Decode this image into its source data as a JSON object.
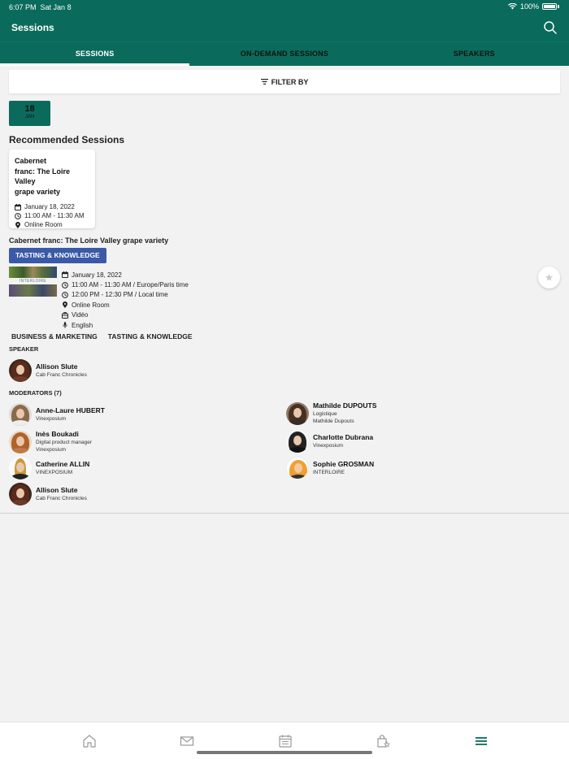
{
  "status": {
    "time": "6:07 PM",
    "date": "Sat Jan 8",
    "battery": "100%"
  },
  "header": {
    "title": "Sessions"
  },
  "tabs": [
    {
      "label": "SESSIONS",
      "active": true
    },
    {
      "label": "ON-DEMAND SESSIONS",
      "active": false
    },
    {
      "label": "SPEAKERS",
      "active": false
    }
  ],
  "filter": {
    "label": "FILTER BY"
  },
  "date_chip": {
    "day": "18",
    "month": "JAN"
  },
  "recommended": {
    "title": "Recommended Sessions",
    "card": {
      "title_line1": "Cabernet",
      "title_line2": "franc: The Loire Valley",
      "title_line3": "grape variety",
      "date": "January 18, 2022",
      "time": "11:00 AM - 11:30 AM",
      "location": "Online Room"
    }
  },
  "session": {
    "title": "Cabernet franc: The Loire Valley grape variety",
    "track": "TASTING & KNOWLEDGE",
    "thumb_text": "INTERLOIRE",
    "date": "January 18, 2022",
    "time_paris": "11:00 AM - 11:30 AM / Europe/Paris time",
    "time_local": "12:00 PM - 12:30 PM / Local time",
    "location": "Online Room",
    "format": "Vidéo",
    "language": "English",
    "tags": [
      "BUSINESS & MARKETING",
      "TASTING & KNOWLEDGE"
    ]
  },
  "speaker_section": {
    "label": "SPEAKER",
    "speaker": {
      "name": "Allison Slute",
      "org": "Cab Franc Chronicles"
    }
  },
  "moderators_section": {
    "label": "MODERATORS (7)",
    "left": [
      {
        "name": "Anne-Laure HUBERT",
        "line1": "Vinexposium",
        "line2": ""
      },
      {
        "name": "Inès Boukadi",
        "line1": "Digital product manager",
        "line2": "Vinexposium"
      },
      {
        "name": "Catherine ALLIN",
        "line1": "VINEXPOSIUM",
        "line2": ""
      },
      {
        "name": "Allison Slute",
        "line1": "Cab Franc Chronicles",
        "line2": ""
      }
    ],
    "right": [
      {
        "name": "Mathilde DUPOUTS",
        "line1": "Logistique",
        "line2": "Mathilde Dupouts"
      },
      {
        "name": "Charlotte Dubrana",
        "line1": "Vinexposium",
        "line2": ""
      },
      {
        "name": "Sophie GROSMAN",
        "line1": "INTERLOIRE",
        "line2": ""
      }
    ]
  },
  "bottom_nav": {
    "items": [
      "home-icon",
      "mail-icon",
      "calendar-icon",
      "bag-star-icon",
      "menu-icon"
    ],
    "active": "menu-icon"
  },
  "colors": {
    "brand": "#0a6b5c",
    "track": "#3a5aa8",
    "background": "#f2f2f2"
  }
}
